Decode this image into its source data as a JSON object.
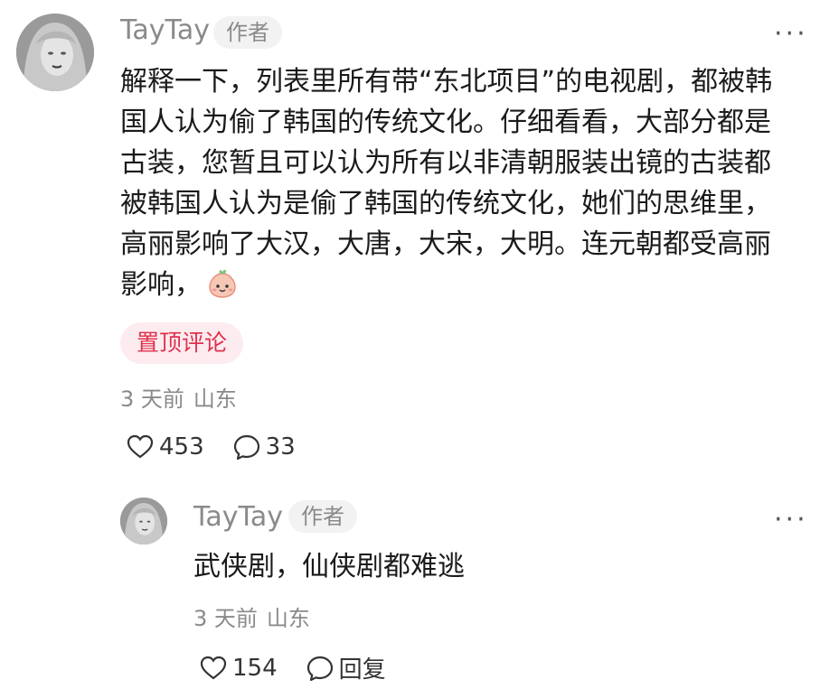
{
  "main_comment": {
    "user_name": "TayTay",
    "author_tag": "作者",
    "more": "···",
    "text_lines": [
      "解释一下，列表里所有带“东北项目”的电视剧，都被韩",
      "国人认为偷了韩国的传统文化。仔细看看，大部分都是",
      "古装，您暂且可以认为所有以非清朝服装出镜的古装都",
      "被韩国人认为是偷了韩国的传统文化，她们的思维里，",
      "高丽影响了大汉，大唐，大宋，大明。连元朝都受高丽",
      "影响，"
    ],
    "emoji": "smile-peach-emoji",
    "pin_label": "置顶评论",
    "time": "3 天前",
    "location": "山东",
    "likes": "453",
    "replies": "33"
  },
  "reply_comment": {
    "user_name": "TayTay",
    "author_tag": "作者",
    "more": "···",
    "text": "武侠剧，仙侠剧都难逃",
    "time": "3 天前",
    "location": "山东",
    "likes": "154",
    "reply_label": "回复"
  },
  "colors": {
    "pin_bg": "#fdecef",
    "pin_text": "#e0304e",
    "meta": "#8a8a8a"
  }
}
